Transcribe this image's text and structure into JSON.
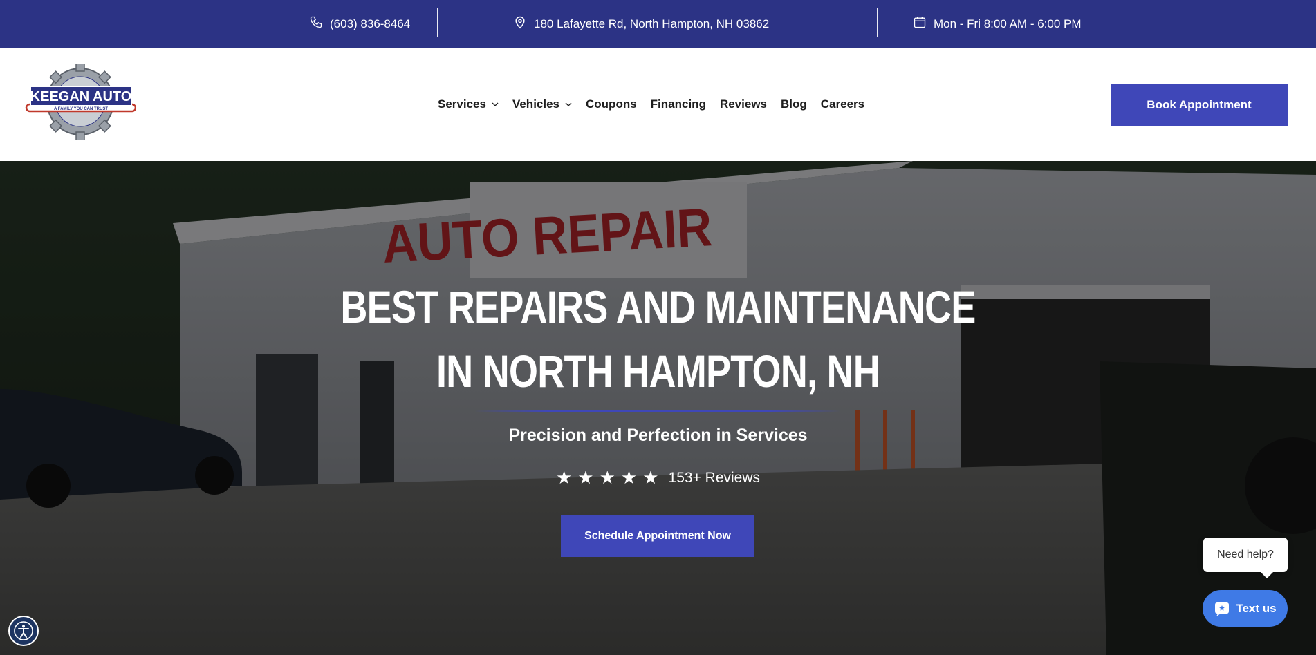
{
  "topbar": {
    "phone": "(603) 836-8464",
    "address": "180 Lafayette Rd, North Hampton, NH 03862",
    "hours": "Mon - Fri 8:00 AM - 6:00 PM",
    "icons": [
      "phone-icon",
      "location-pin-icon",
      "calendar-icon"
    ]
  },
  "logo": {
    "name": "KEEGAN AUTO",
    "tagline": "A FAMILY YOU CAN TRUST"
  },
  "nav": {
    "items": [
      {
        "label": "Services",
        "dropdown": true
      },
      {
        "label": "Vehicles",
        "dropdown": true
      },
      {
        "label": "Coupons",
        "dropdown": false
      },
      {
        "label": "Financing",
        "dropdown": false
      },
      {
        "label": "Reviews",
        "dropdown": false
      },
      {
        "label": "Blog",
        "dropdown": false
      },
      {
        "label": "Careers",
        "dropdown": false
      }
    ],
    "cta": "Book Appointment"
  },
  "hero": {
    "title_line1": "BEST REPAIRS AND MAINTENANCE",
    "title_line2": "IN NORTH HAMPTON, NH",
    "subtitle": "Precision and Perfection in Services",
    "rating_stars": 5,
    "reviews_text": "153+ Reviews",
    "cta": "Schedule Appointment Now",
    "background_sign": "AUTO REPAIR"
  },
  "chat": {
    "bubble": "Need help?",
    "button": "Text us"
  },
  "colors": {
    "topbar": "#2c3385",
    "accent": "#3f47b8",
    "chat": "#3f7ae6"
  }
}
